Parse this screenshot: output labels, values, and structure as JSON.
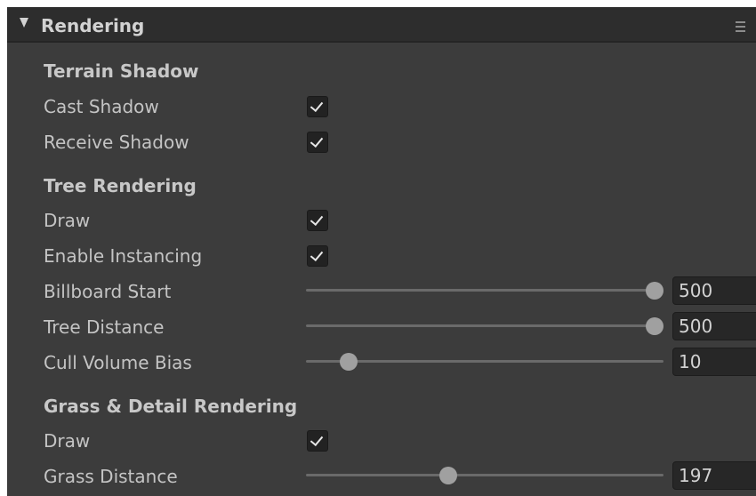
{
  "header": {
    "title": "Rendering"
  },
  "terrain_shadow": {
    "title": "Terrain Shadow",
    "cast_shadow": {
      "label": "Cast Shadow",
      "checked": true
    },
    "receive_shadow": {
      "label": "Receive Shadow",
      "checked": true
    }
  },
  "tree_rendering": {
    "title": "Tree Rendering",
    "draw": {
      "label": "Draw",
      "checked": true
    },
    "enable_instancing": {
      "label": "Enable Instancing",
      "checked": true
    },
    "billboard_start": {
      "label": "Billboard Start",
      "value": "500",
      "fraction": 1.0
    },
    "tree_distance": {
      "label": "Tree Distance",
      "value": "500",
      "fraction": 1.0
    },
    "cull_volume_bias": {
      "label": "Cull Volume Bias",
      "value": "10",
      "fraction": 0.1
    }
  },
  "grass_detail": {
    "title": "Grass & Detail Rendering",
    "draw": {
      "label": "Draw",
      "checked": true
    },
    "grass_distance": {
      "label": "Grass Distance",
      "value": "197",
      "fraction": 0.394
    }
  },
  "colors": {
    "panel_bg": "#3c3c3c",
    "header_bg": "#2d2d2d",
    "text": "#c4c4c4"
  },
  "icons": {
    "fold": "triangle-down-icon",
    "menu": "menu-icon",
    "check": "checkmark-icon"
  }
}
